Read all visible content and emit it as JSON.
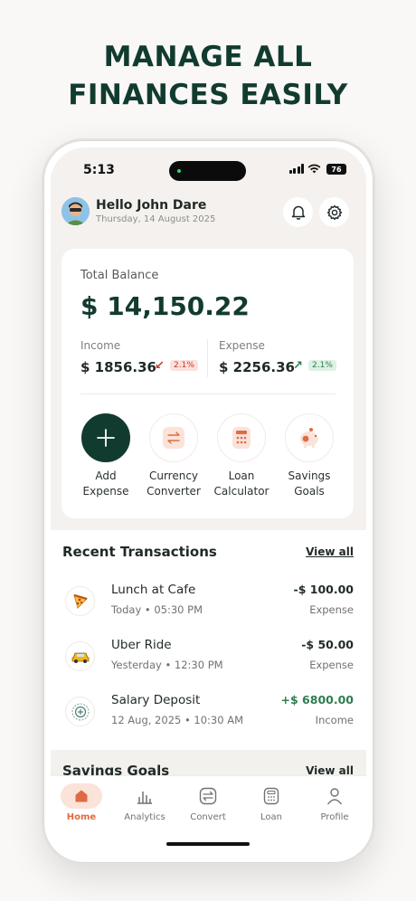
{
  "headline": {
    "line1": "MANAGE ALL",
    "line2": "FINANCES EASILY"
  },
  "status_bar": {
    "time": "5:13",
    "battery": "76"
  },
  "header": {
    "greeting": "Hello John Dare",
    "date": "Thursday, 14 August 2025",
    "avatar_icon": "user-avatar-icon",
    "notification_icon": "bell-icon",
    "settings_icon": "gear-icon"
  },
  "balance": {
    "label": "Total Balance",
    "amount": "$ 14,150.22",
    "income": {
      "label": "Income",
      "amount": "$ 1856.36",
      "change": "2.1%",
      "direction": "down",
      "color": "#c0392b"
    },
    "expense": {
      "label": "Expense",
      "amount": "$ 2256.36",
      "change": "2.1%",
      "direction": "up",
      "color": "#2e7d4f"
    }
  },
  "actions": [
    {
      "line1": "Add",
      "line2": "Expense",
      "icon": "plus-icon"
    },
    {
      "line1": "Currency",
      "line2": "Converter",
      "icon": "exchange-icon"
    },
    {
      "line1": "Loan",
      "line2": "Calculator",
      "icon": "calculator-icon"
    },
    {
      "line1": "Savings",
      "line2": "Goals",
      "icon": "piggy-bank-icon"
    }
  ],
  "recent": {
    "title": "Recent Transactions",
    "view_all": "View all",
    "items": [
      {
        "name": "Lunch at Cafe",
        "meta": "Today • 05:30 PM",
        "amount": "-$ 100.00",
        "type": "Expense",
        "icon": "pizza-icon"
      },
      {
        "name": "Uber Ride",
        "meta": "Yesterday • 12:30 PM",
        "amount": "-$ 50.00",
        "type": "Expense",
        "icon": "taxi-icon"
      },
      {
        "name": "Salary Deposit",
        "meta": "12 Aug, 2025 • 10:30 AM",
        "amount": "+$ 6800.00",
        "type": "Income",
        "icon": "salary-icon"
      }
    ]
  },
  "savings": {
    "title": "Savings Goals",
    "view_all": "View all"
  },
  "nav": [
    {
      "label": "Home",
      "icon": "home-icon",
      "active": true
    },
    {
      "label": "Analytics",
      "icon": "analytics-icon",
      "active": false
    },
    {
      "label": "Convert",
      "icon": "convert-icon",
      "active": false
    },
    {
      "label": "Loan",
      "icon": "loan-icon",
      "active": false
    },
    {
      "label": "Profile",
      "icon": "profile-icon",
      "active": false
    }
  ],
  "colors": {
    "brand": "#123b30",
    "accent": "#e06b43",
    "positive": "#2e7d4f",
    "negative": "#c0392b"
  }
}
